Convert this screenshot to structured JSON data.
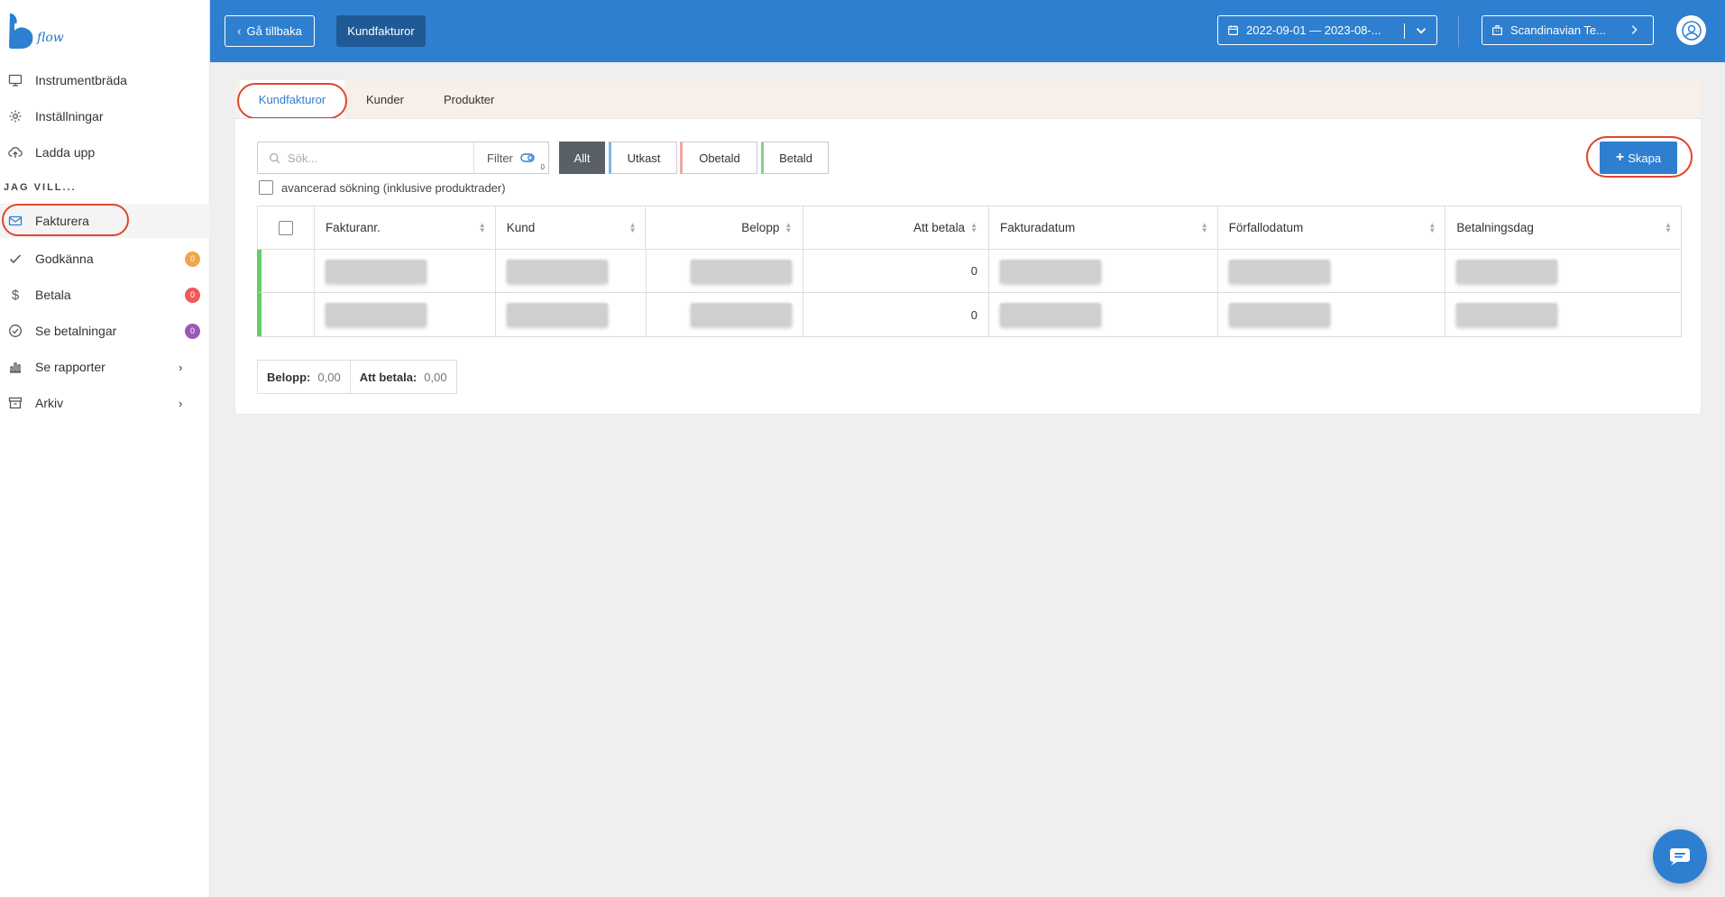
{
  "app": {
    "logo_text": "flow",
    "accent": "#2e7fcf",
    "highlight": "#e0462f"
  },
  "sidebar": {
    "items": [
      {
        "label": "Instrumentbräda",
        "icon": "monitor-icon"
      },
      {
        "label": "Inställningar",
        "icon": "gear-icon"
      },
      {
        "label": "Ladda upp",
        "icon": "cloud-upload-icon"
      }
    ],
    "section_label": "JAG VILL...",
    "actions": [
      {
        "label": "Fakturera",
        "icon": "envelope-icon",
        "active": true
      },
      {
        "label": "Godkänna",
        "icon": "check-icon",
        "badge": "0",
        "badge_color": "#f0a64a"
      },
      {
        "label": "Betala",
        "icon": "dollar-icon",
        "badge": "0",
        "badge_color": "#ee5a5a"
      },
      {
        "label": "Se betalningar",
        "icon": "check-circle-icon",
        "badge": "0",
        "badge_color": "#9b59b6"
      },
      {
        "label": "Se rapporter",
        "icon": "bar-chart-icon",
        "chevron": "›"
      },
      {
        "label": "Arkiv",
        "icon": "archive-icon",
        "chevron": "›"
      }
    ]
  },
  "header": {
    "back_label": "Gå tillbaka",
    "breadcrumb": "Kundfakturor",
    "date_range": "2022-09-01 — 2023-08-...",
    "company": "Scandinavian Te..."
  },
  "tabs": [
    {
      "label": "Kundfakturor",
      "active": true
    },
    {
      "label": "Kunder"
    },
    {
      "label": "Produkter"
    }
  ],
  "toolbar": {
    "search_placeholder": "Sök...",
    "filter_label": "Filter",
    "filter_count": "0",
    "segments": [
      "Allt",
      "Utkast",
      "Obetald",
      "Betald"
    ],
    "create_label": "Skapa",
    "advanced_label": "avancerad sökning (inklusive produktrader)"
  },
  "table": {
    "columns": [
      "Fakturanr.",
      "Kund",
      "Belopp",
      "Att betala",
      "Fakturadatum",
      "Förfallodatum",
      "Betalningsdag"
    ],
    "rows": [
      {
        "att_betala": "0"
      },
      {
        "att_betala": "0"
      }
    ]
  },
  "totals": {
    "belopp_label": "Belopp:",
    "belopp_value": "0,00",
    "att_betala_label": "Att betala:",
    "att_betala_value": "0,00"
  }
}
